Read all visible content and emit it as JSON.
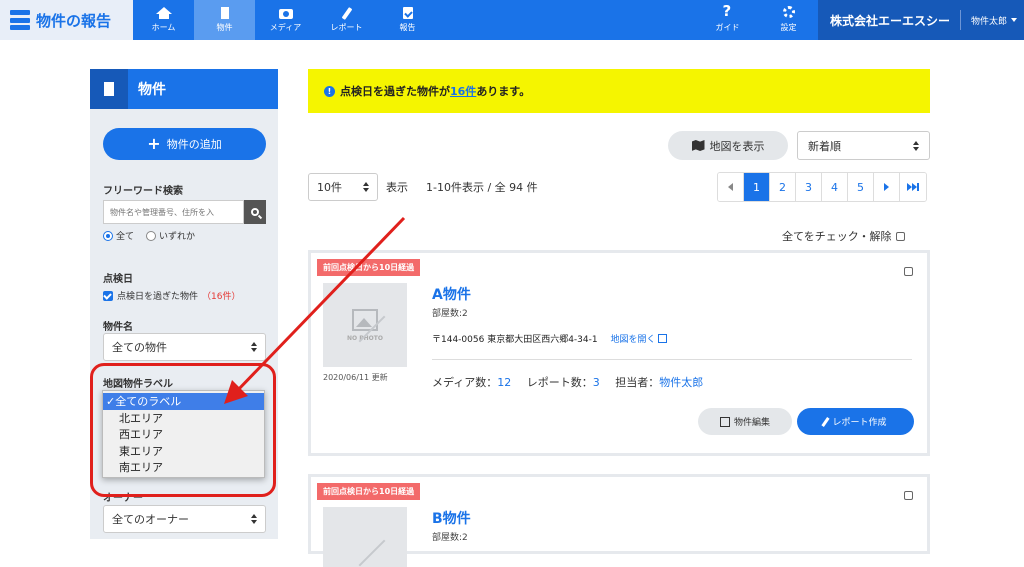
{
  "header": {
    "logo_text": "物件の報告",
    "nav": [
      {
        "label": "ホーム",
        "icon": "home-icon"
      },
      {
        "label": "物件",
        "icon": "building-icon",
        "active": true
      },
      {
        "label": "メディア",
        "icon": "camera-icon"
      },
      {
        "label": "レポート",
        "icon": "pen-icon"
      },
      {
        "label": "報告",
        "icon": "clipboard-check-icon"
      }
    ],
    "right_nav": [
      {
        "label": "ガイド",
        "icon": "question-icon"
      },
      {
        "label": "設定",
        "icon": "gear-icon"
      }
    ],
    "company": "株式会社エーエスシー",
    "user": "物件太郎",
    "colors": {
      "primary": "#1a73e8",
      "dark": "#1659b8",
      "alert": "#f5f500",
      "badge": "#f36a6a"
    }
  },
  "sidebar": {
    "title": "物件",
    "add_button": "物件の追加",
    "freeword_label": "フリーワード検索",
    "search_placeholder": "物件名や管理番号、住所を入",
    "radio_all": "全て",
    "radio_any": "いずれか",
    "inspection_label": "点検日",
    "inspection_check": "点検日を過ぎた物件",
    "inspection_count": "（16件）",
    "property_name_label": "物件名",
    "property_name_value": "全ての物件",
    "map_label_label": "地図物件ラベル",
    "map_label_options": [
      "✓全てのラベル",
      "北エリア",
      "西エリア",
      "東エリア",
      "南エリア"
    ],
    "owner_label": "オーナー",
    "owner_value": "全てのオーナー"
  },
  "main": {
    "alert_pre": "点検日を過ぎた物件が",
    "alert_link": "16件",
    "alert_post": "あります。",
    "map_button": "地図を表示",
    "sort_value": "新着順",
    "per_page": "10件",
    "show_label": "表示",
    "count_text": "1-10件表示 / 全 94 件",
    "pages": [
      "1",
      "2",
      "3",
      "4",
      "5"
    ],
    "check_all": "全てをチェック・解除",
    "cards": [
      {
        "badge": "前回点検日から10日経過",
        "photo_text": "NO PHOTO",
        "date": "2020/06/11 更新",
        "name": "A物件",
        "rooms": "部屋数:2",
        "address": "〒144-0056 東京都大田区西六郷4-34-1",
        "map_link": "地図を開く",
        "media_label": "メディア数：",
        "media_count": "12",
        "report_label": "レポート数：",
        "report_count": "3",
        "staff_label": "担当者：",
        "staff": "物件太郎",
        "edit_button": "物件編集",
        "report_button": "レポート作成"
      },
      {
        "badge": "前回点検日から10日経過",
        "name": "B物件",
        "rooms": "部屋数:2"
      }
    ]
  }
}
